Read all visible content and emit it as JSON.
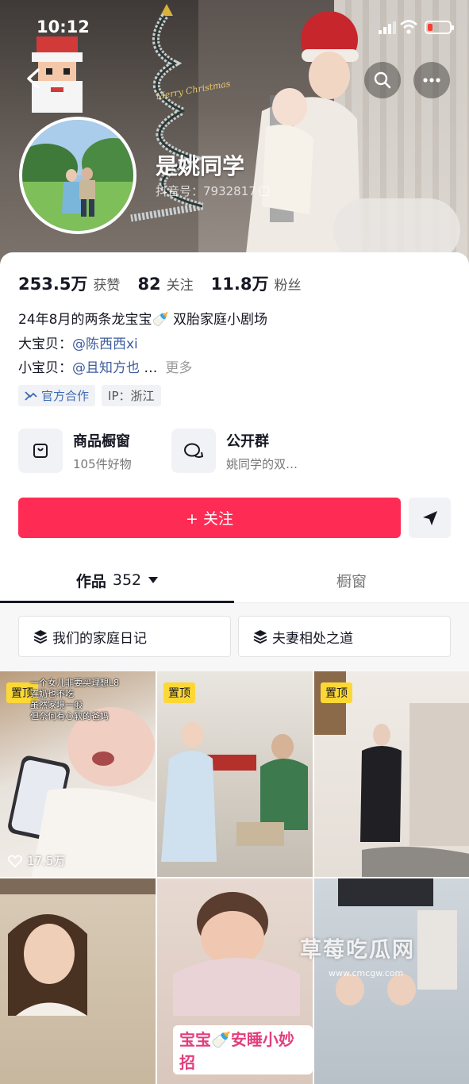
{
  "status_bar": {
    "time": "10:12"
  },
  "cover": {
    "xmas_text": "Merry Christmas"
  },
  "profile": {
    "nickname": "是姚同学",
    "douyin_id": "抖音号：7932817"
  },
  "stats": [
    {
      "value": "253.5万",
      "label": "获赞"
    },
    {
      "value": "82",
      "label": "关注"
    },
    {
      "value": "11.8万",
      "label": "粉丝"
    }
  ],
  "bio": {
    "line1": "24年8月的两条龙宝宝🍼 双胎家庭小剧场",
    "line2_prefix": "大宝贝：",
    "line2_mention": "@陈西西xi",
    "line3_prefix": "小宝贝：",
    "line3_mention": "@且知方也",
    "line3_ellipsis": "…",
    "more": "更多"
  },
  "tags": {
    "official": "官方合作",
    "ip": "IP：浙江"
  },
  "features": [
    {
      "title": "商品橱窗",
      "subtitle": "105件好物"
    },
    {
      "title": "公开群",
      "subtitle": "姚同学的双…"
    }
  ],
  "follow_button": "+ 关注",
  "tabs": {
    "works_label": "作品",
    "works_count": "352",
    "showcase_label": "橱窗"
  },
  "collections": [
    "我们的家庭日记",
    "夫妻相处之道"
  ],
  "videos": [
    {
      "pinned": "置顶",
      "caption": "一个女儿非要买理想L8\n连奶也不吃\n虽然家境一般\n但奈何有心软的爸妈",
      "likes": "17.5万"
    },
    {
      "pinned": "置顶"
    },
    {
      "pinned": "置顶"
    },
    {},
    {
      "overlay": "宝宝🍼安睡小妙招"
    },
    {}
  ],
  "watermark": {
    "text": "草莓吃瓜网",
    "url": "www.cmcgw.com"
  },
  "colors": {
    "accent": "#fe2c55",
    "mention": "#3e5c9c",
    "pin": "#fdd835"
  }
}
